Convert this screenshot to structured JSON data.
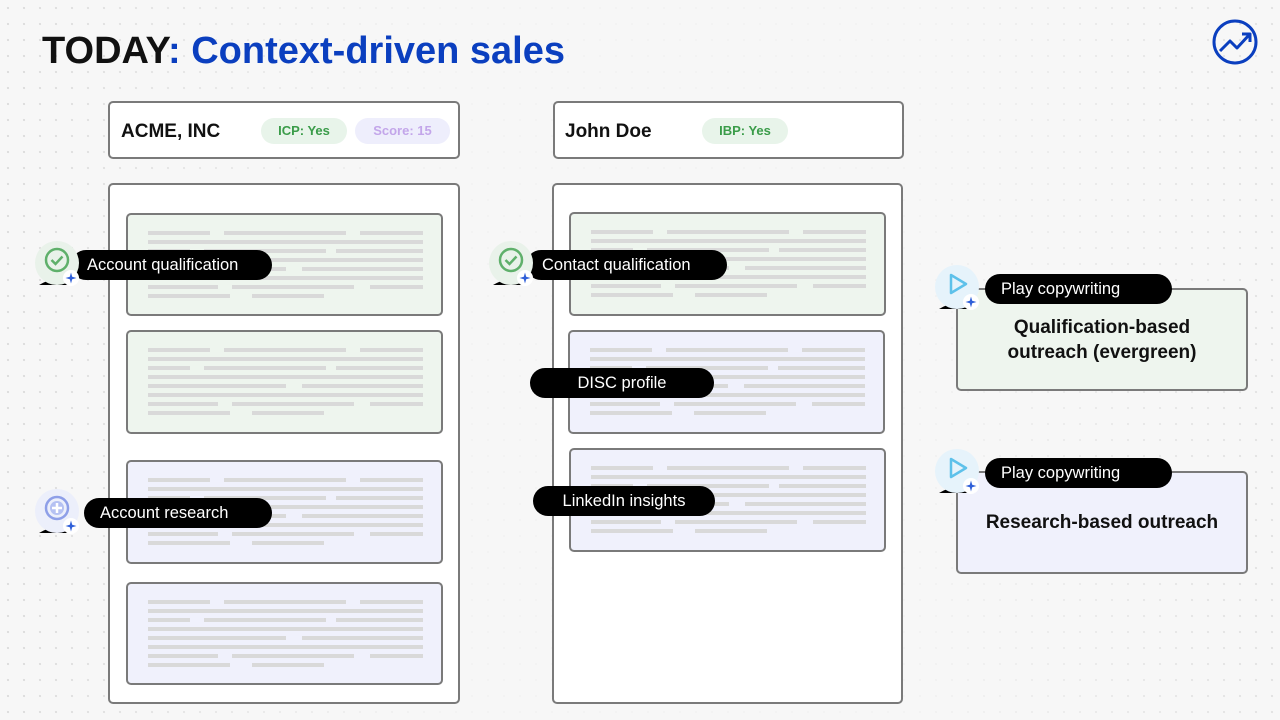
{
  "title": {
    "prefix": "TODAY",
    "rest": ": Context-driven sales"
  },
  "account": {
    "name": "ACME, INC",
    "icp_badge": "ICP: Yes",
    "score_badge": "Score: 15"
  },
  "contact": {
    "name": "John Doe",
    "ibp_badge": "IBP: Yes"
  },
  "labels": {
    "account_qualification": "Account qualification",
    "account_research": "Account research",
    "contact_qualification": "Contact qualification",
    "disc_profile": "DISC profile",
    "linkedin_insights": "LinkedIn insights",
    "play_copywriting_1": "Play copywriting",
    "play_copywriting_2": "Play copywriting"
  },
  "outputs": {
    "qualification_line1": "Qualification-based",
    "qualification_line2": "outreach (evergreen)",
    "research": "Research-based outreach"
  },
  "colors": {
    "title_blue": "#0b3fbf",
    "green_card": "#eef5ee",
    "purple_card": "#f0f1fc",
    "badge_green_text": "#3a9c49",
    "badge_lavender_text": "#c3a6ea",
    "tag_background": "#000000"
  },
  "icons": {
    "logo": "growth-chart-logo",
    "check": "check-circle-icon",
    "plus": "plus-circle-icon",
    "play": "play-icon",
    "sparkle": "sparkle-icon"
  }
}
